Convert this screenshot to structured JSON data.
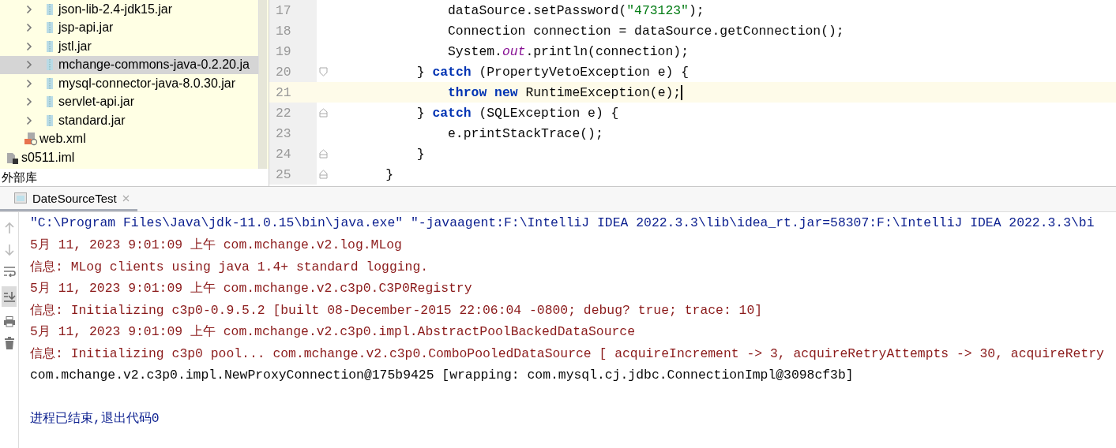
{
  "project_tree": {
    "items": [
      {
        "label": "json-lib-2.4-jdk15.jar",
        "kind": "library",
        "selected": false
      },
      {
        "label": "jsp-api.jar",
        "kind": "library",
        "selected": false
      },
      {
        "label": "jstl.jar",
        "kind": "library",
        "selected": false
      },
      {
        "label": "mchange-commons-java-0.2.20.ja",
        "kind": "library",
        "selected": true
      },
      {
        "label": "mysql-connector-java-8.0.30.jar",
        "kind": "library",
        "selected": false
      },
      {
        "label": "servlet-api.jar",
        "kind": "library",
        "selected": false
      },
      {
        "label": "standard.jar",
        "kind": "library",
        "selected": false
      },
      {
        "label": "web.xml",
        "kind": "xml",
        "selected": false
      },
      {
        "label": "s0511.iml",
        "kind": "module",
        "selected": false
      }
    ],
    "footer": "外部库"
  },
  "editor": {
    "lines": [
      {
        "number": "17",
        "current": false,
        "fold_start": false,
        "fold_end": false,
        "tokens": [
          {
            "text": "            dataSource.setPassword(",
            "kind": "plain"
          },
          {
            "text": "\"473123\"",
            "kind": "string"
          },
          {
            "text": ");",
            "kind": "plain"
          }
        ]
      },
      {
        "number": "18",
        "current": false,
        "fold_start": false,
        "fold_end": false,
        "tokens": [
          {
            "text": "            Connection connection = dataSource.getConnection();",
            "kind": "plain"
          }
        ]
      },
      {
        "number": "19",
        "current": false,
        "fold_start": false,
        "fold_end": false,
        "tokens": [
          {
            "text": "            System.",
            "kind": "plain"
          },
          {
            "text": "out",
            "kind": "field"
          },
          {
            "text": ".println(connection);",
            "kind": "plain"
          }
        ]
      },
      {
        "number": "20",
        "current": false,
        "fold_start": true,
        "fold_end": false,
        "tokens": [
          {
            "text": "        } ",
            "kind": "plain"
          },
          {
            "text": "catch",
            "kind": "keyword"
          },
          {
            "text": " (PropertyVetoException e) {",
            "kind": "plain"
          }
        ]
      },
      {
        "number": "21",
        "current": true,
        "fold_start": false,
        "fold_end": false,
        "tokens": [
          {
            "text": "            throw",
            "kind": "keyword"
          },
          {
            "text": " new",
            "kind": "keyword"
          },
          {
            "text": " RuntimeException(e);",
            "kind": "plain"
          }
        ]
      },
      {
        "number": "22",
        "current": false,
        "fold_start": false,
        "fold_end": true,
        "tokens": [
          {
            "text": "        } ",
            "kind": "plain"
          },
          {
            "text": "catch",
            "kind": "keyword"
          },
          {
            "text": " (SQLException e) {",
            "kind": "plain"
          }
        ]
      },
      {
        "number": "23",
        "current": false,
        "fold_start": false,
        "fold_end": false,
        "tokens": [
          {
            "text": "            e.printStackTrace();",
            "kind": "plain"
          }
        ]
      },
      {
        "number": "24",
        "current": false,
        "fold_start": false,
        "fold_end": true,
        "tokens": [
          {
            "text": "        }",
            "kind": "plain"
          }
        ]
      },
      {
        "number": "25",
        "current": false,
        "fold_start": false,
        "fold_end": true,
        "tokens": [
          {
            "text": "    }",
            "kind": "plain"
          }
        ]
      }
    ]
  },
  "run_panel": {
    "tab": {
      "label": "DateSourceTest",
      "selected": true
    },
    "lines": [
      {
        "text": "\"C:\\Program Files\\Java\\jdk-11.0.15\\bin\\java.exe\" \"-javaagent:F:\\IntelliJ IDEA 2022.3.3\\lib\\idea_rt.jar=58307:F:\\IntelliJ IDEA 2022.3.3\\bi",
        "kind": "command"
      },
      {
        "text": "5月 11, 2023 9:01:09 上午 com.mchange.v2.log.MLog",
        "kind": "stderr"
      },
      {
        "text": "信息: MLog clients using java 1.4+ standard logging.",
        "kind": "stderr"
      },
      {
        "text": "5月 11, 2023 9:01:09 上午 com.mchange.v2.c3p0.C3P0Registry",
        "kind": "stderr"
      },
      {
        "text": "信息: Initializing c3p0-0.9.5.2 [built 08-December-2015 22:06:04 -0800; debug? true; trace: 10]",
        "kind": "stderr"
      },
      {
        "text": "5月 11, 2023 9:01:09 上午 com.mchange.v2.c3p0.impl.AbstractPoolBackedDataSource",
        "kind": "stderr"
      },
      {
        "text": "信息: Initializing c3p0 pool... com.mchange.v2.c3p0.ComboPooledDataSource [ acquireIncrement -> 3, acquireRetryAttempts -> 30, acquireRetry",
        "kind": "stderr"
      },
      {
        "text": "com.mchange.v2.c3p0.impl.NewProxyConnection@175b9425 [wrapping: com.mysql.cj.jdbc.ConnectionImpl@3098cf3b]",
        "kind": "stdout"
      },
      {
        "text": "进程已结束,退出代码0",
        "kind": "exit"
      }
    ]
  }
}
